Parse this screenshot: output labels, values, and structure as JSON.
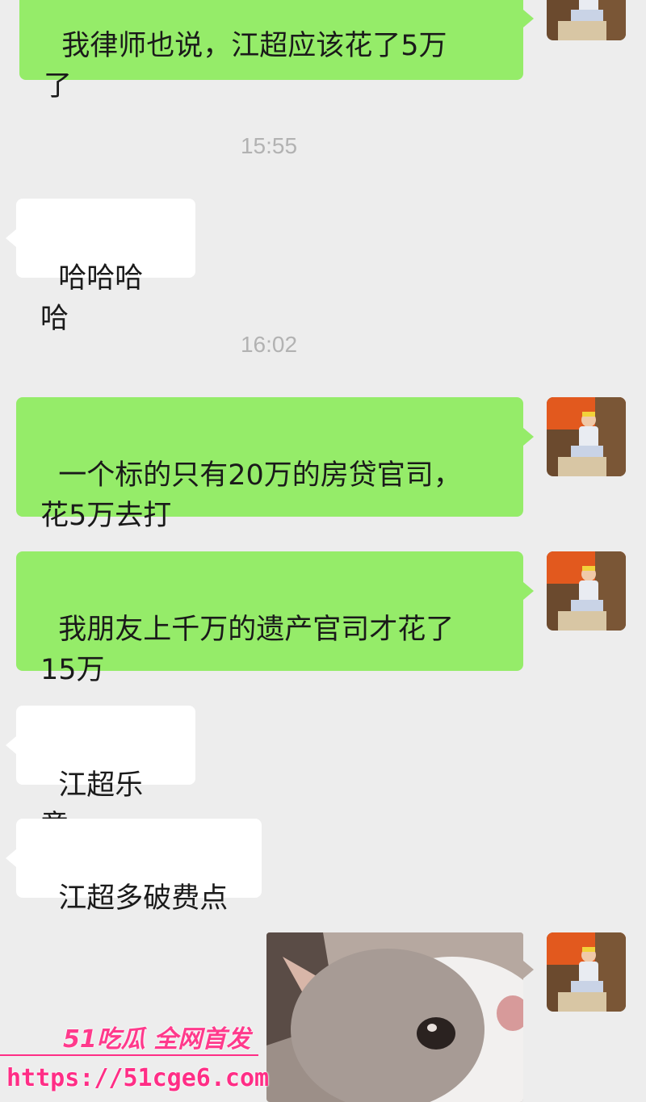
{
  "messages": [
    {
      "text": "我律师也说，江超应该花了5万\n了"
    },
    {
      "time": "15:55"
    },
    {
      "text": "哈哈哈哈"
    },
    {
      "time": "16:02"
    },
    {
      "text": "一个标的只有20万的房贷官司，\n花5万去打"
    },
    {
      "text": "我朋友上千万的遗产官司才花了\n15万"
    },
    {
      "text": "江超乐意"
    },
    {
      "text": "江超多破费点"
    }
  ],
  "watermark": {
    "logo": "51吃瓜 全网首发",
    "url": "https://51cge6.com"
  },
  "colors": {
    "self_bubble": "#95ec69",
    "other_bubble": "#ffffff",
    "background": "#ededed",
    "watermark": "#ff2e86"
  }
}
